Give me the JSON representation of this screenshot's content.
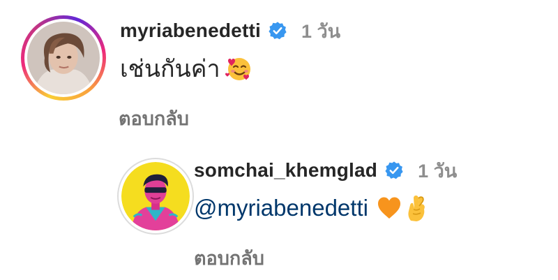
{
  "comments": [
    {
      "username": "myriabenedetti",
      "time": "1 วัน",
      "text": "เช่นกันค่า",
      "emoji": "smiling-face-with-hearts",
      "reply_label": "ตอบกลับ",
      "verified": true
    },
    {
      "username": "somchai_khemglad",
      "time": "1 วัน",
      "mention": "@myriabenedetti",
      "emojis": [
        "orange-heart",
        "crossed-fingers-hand"
      ],
      "reply_label": "ตอบกลับ",
      "verified": true
    }
  ],
  "colors": {
    "verified_blue": "#3897f0",
    "mention_blue": "#00376b",
    "muted_gray": "#8e8e8e"
  }
}
